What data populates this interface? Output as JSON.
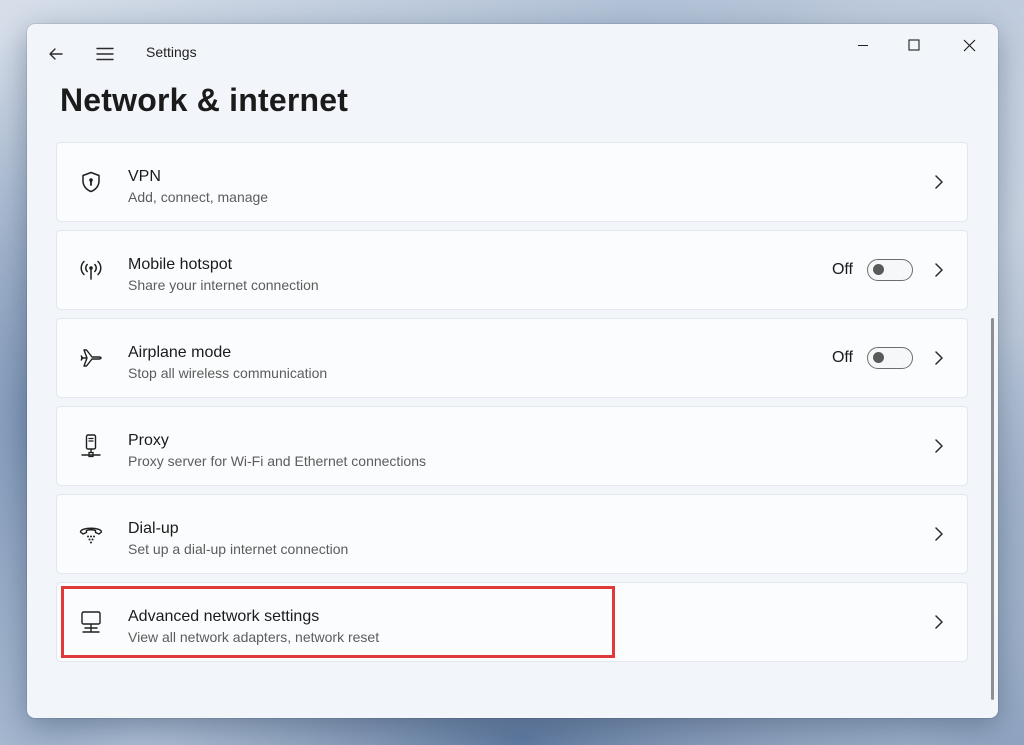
{
  "window": {
    "app_title": "Settings",
    "page_title": "Network & internet"
  },
  "items": [
    {
      "id": "vpn",
      "title": "VPN",
      "subtitle": "Add, connect, manage",
      "icon": "shield-icon"
    },
    {
      "id": "mobile-hotspot",
      "title": "Mobile hotspot",
      "subtitle": "Share your internet connection",
      "icon": "hotspot-icon",
      "toggle": {
        "state": "Off"
      }
    },
    {
      "id": "airplane-mode",
      "title": "Airplane mode",
      "subtitle": "Stop all wireless communication",
      "icon": "airplane-icon",
      "toggle": {
        "state": "Off"
      }
    },
    {
      "id": "proxy",
      "title": "Proxy",
      "subtitle": "Proxy server for Wi-Fi and Ethernet connections",
      "icon": "proxy-icon"
    },
    {
      "id": "dial-up",
      "title": "Dial-up",
      "subtitle": "Set up a dial-up internet connection",
      "icon": "dialup-phone-icon"
    },
    {
      "id": "advanced-network-settings",
      "title": "Advanced network settings",
      "subtitle": "View all network adapters, network reset",
      "icon": "network-computer-icon",
      "highlighted": true
    }
  ],
  "colors": {
    "highlight": "#e0393a",
    "window_bg": "#f2f5f9",
    "card_bg": "#fbfcfd"
  }
}
